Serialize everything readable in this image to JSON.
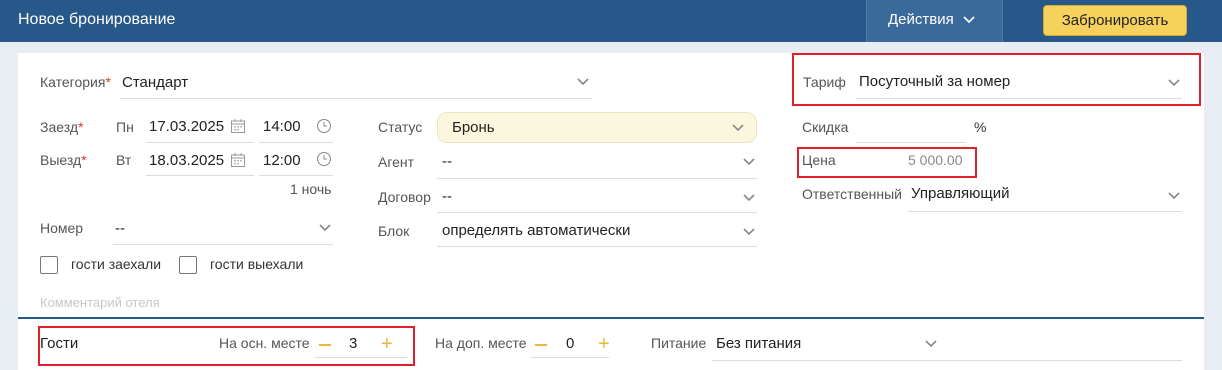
{
  "header": {
    "title": "Новое бронирование",
    "actions_label": "Действия",
    "book_label": "Забронировать"
  },
  "form": {
    "category": {
      "label": "Категория",
      "required_mark": "*",
      "value": "Стандарт"
    },
    "checkin": {
      "label": "Заезд",
      "required_mark": "*",
      "weekday": "Пн",
      "date": "17.03.2025",
      "time": "14:00"
    },
    "checkout": {
      "label": "Выезд",
      "required_mark": "*",
      "weekday": "Вт",
      "date": "18.03.2025",
      "time": "12:00"
    },
    "nights": "1 ночь",
    "room": {
      "label": "Номер",
      "value": "--"
    },
    "guests_checked_in": "гости заехали",
    "guests_checked_out": "гости выехали",
    "comment_placeholder": "Комментарий отеля",
    "status": {
      "label": "Статус",
      "value": "Бронь"
    },
    "agent": {
      "label": "Агент",
      "value": "--"
    },
    "contract": {
      "label": "Договор",
      "value": "--"
    },
    "block": {
      "label": "Блок",
      "value": "определять автоматически"
    },
    "tariff": {
      "label": "Тариф",
      "value": "Посуточный за номер"
    },
    "discount": {
      "label": "Скидка",
      "unit": "%"
    },
    "price": {
      "label": "Цена",
      "value": "5 000.00"
    },
    "responsible": {
      "label": "Ответственный",
      "value": "Управляющий"
    }
  },
  "guests": {
    "label": "Гости",
    "main_place": {
      "label": "На осн. месте",
      "value": "3"
    },
    "extra_place": {
      "label": "На доп. месте",
      "value": "0"
    },
    "meals": {
      "label": "Питание",
      "value": "Без питания"
    }
  },
  "icons": {
    "chevron": "chevron-down-icon",
    "calendar": "calendar-icon",
    "clock": "clock-icon",
    "minus": "minus-icon",
    "plus": "plus-icon"
  },
  "colors": {
    "header_bg": "#26598a",
    "book_button": "#f6d25d",
    "highlight_border": "#e0202a",
    "status_bg": "#fbf7df"
  }
}
